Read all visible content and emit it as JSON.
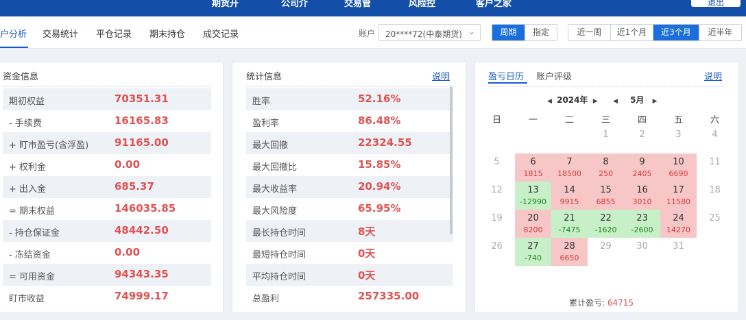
{
  "topbar": {
    "items": [
      "期货开",
      "公司介",
      "交易管",
      "风险控",
      "客户之家"
    ],
    "button": "退出"
  },
  "subnav": {
    "tabs": [
      "户分析",
      "交易统计",
      "平仓记录",
      "期末持仓",
      "成交记录"
    ],
    "account_label": "账户",
    "account_value": "20****72(中泰期货)",
    "period_mode": [
      "周期",
      "指定"
    ],
    "ranges": [
      "近一周",
      "近1个月",
      "近3个月",
      "近半年"
    ]
  },
  "funds": {
    "title": "资金信息",
    "rows": [
      {
        "label": "期初权益",
        "value": "70351.31"
      },
      {
        "label": "-  手续费",
        "value": "16165.83"
      },
      {
        "label": "+ 盯市盈亏(含浮盈)",
        "value": "91165.00"
      },
      {
        "label": "+ 权利金",
        "value": "0.00"
      },
      {
        "label": "+ 出入金",
        "value": "685.37"
      },
      {
        "label": "= 期末权益",
        "value": "146035.85"
      },
      {
        "label": "-  持仓保证金",
        "value": "48442.50"
      },
      {
        "label": "-  冻结资金",
        "value": "0.00"
      },
      {
        "label": "= 可用资金",
        "value": "94343.35"
      },
      {
        "label": "盯市收益",
        "value": "74999.17"
      }
    ]
  },
  "stats": {
    "title": "统计信息",
    "explain": "说明",
    "rows": [
      {
        "label": "胜率",
        "value": "52.16%"
      },
      {
        "label": "盈利率",
        "value": "86.48%"
      },
      {
        "label": "最大回撤",
        "value": "22324.55"
      },
      {
        "label": "最大回撤比",
        "value": "15.85%"
      },
      {
        "label": "最大收益率",
        "value": "20.94%"
      },
      {
        "label": "最大风险度",
        "value": "65.95%"
      },
      {
        "label": "最长持仓时间",
        "value": "8天"
      },
      {
        "label": "最短持仓时间",
        "value": "0天"
      },
      {
        "label": "平均持仓时间",
        "value": "0天"
      },
      {
        "label": "总盈利",
        "value": "257335.00"
      }
    ]
  },
  "calendar": {
    "tabs": [
      "盈亏日历",
      "账户评级"
    ],
    "explain": "说明",
    "year": "2024年",
    "month": "5月",
    "weekdays": [
      "日",
      "一",
      "二",
      "三",
      "四",
      "五",
      "六"
    ],
    "weeks": [
      [
        {
          "d": ""
        },
        {
          "d": ""
        },
        {
          "d": ""
        },
        {
          "d": "1"
        },
        {
          "d": "2"
        },
        {
          "d": "3"
        },
        {
          "d": "4"
        }
      ],
      [
        {
          "d": "5"
        },
        {
          "d": "6",
          "v": "1815",
          "t": "red"
        },
        {
          "d": "7",
          "v": "18500",
          "t": "red"
        },
        {
          "d": "8",
          "v": "250",
          "t": "red"
        },
        {
          "d": "9",
          "v": "2405",
          "t": "red"
        },
        {
          "d": "10",
          "v": "6690",
          "t": "red"
        },
        {
          "d": "11"
        }
      ],
      [
        {
          "d": "12"
        },
        {
          "d": "13",
          "v": "-12990",
          "t": "green"
        },
        {
          "d": "14",
          "v": "9915",
          "t": "red"
        },
        {
          "d": "15",
          "v": "6855",
          "t": "red"
        },
        {
          "d": "16",
          "v": "3010",
          "t": "red"
        },
        {
          "d": "17",
          "v": "11580",
          "t": "red"
        },
        {
          "d": "18"
        }
      ],
      [
        {
          "d": "19"
        },
        {
          "d": "20",
          "v": "8200",
          "t": "red"
        },
        {
          "d": "21",
          "v": "-7475",
          "t": "green"
        },
        {
          "d": "22",
          "v": "-1620",
          "t": "green"
        },
        {
          "d": "23",
          "v": "-2600",
          "t": "green"
        },
        {
          "d": "24",
          "v": "14270",
          "t": "red"
        },
        {
          "d": "25"
        }
      ],
      [
        {
          "d": "26"
        },
        {
          "d": "27",
          "v": "-740",
          "t": "green"
        },
        {
          "d": "28",
          "v": "6650",
          "t": "red"
        },
        {
          "d": "29"
        },
        {
          "d": "30"
        },
        {
          "d": "31"
        },
        {
          "d": ""
        }
      ]
    ],
    "total_label": "累计盈亏:",
    "total_value": "64715"
  },
  "colors": {
    "brand": "#134fa8",
    "accent": "#1a6fdc",
    "profit": "#e05252",
    "loss": "#1e8a1e"
  }
}
